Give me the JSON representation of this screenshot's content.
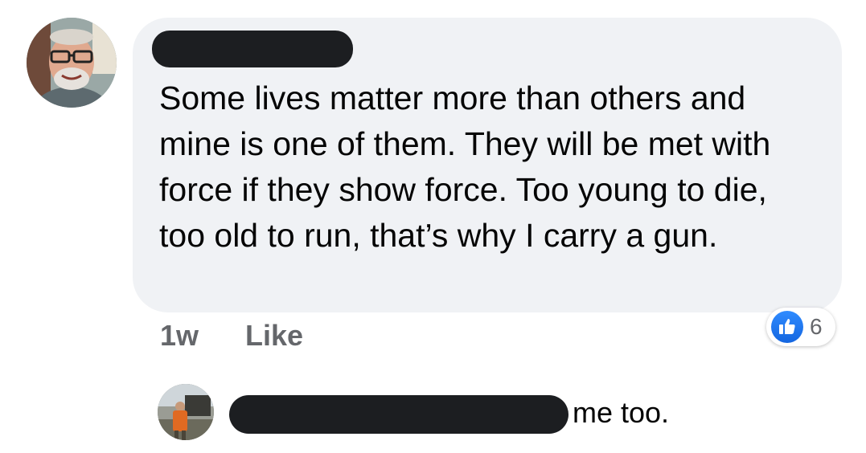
{
  "comment": {
    "author_redacted": true,
    "text": "Some lives matter more than others and mine is one of them. They will be met with force if they show force. Too young to die, too old to run, that’s why I carry a gun.",
    "time": "1w",
    "like_label": "Like",
    "reaction_icon": "like-thumbs-up-icon",
    "reaction_count": "6"
  },
  "reply": {
    "author_redacted": true,
    "text": "me too."
  },
  "colors": {
    "bubble": "#f0f2f5",
    "redaction": "#1c1e21",
    "meta_text": "#65676b",
    "like_blue": "#1877f2"
  }
}
